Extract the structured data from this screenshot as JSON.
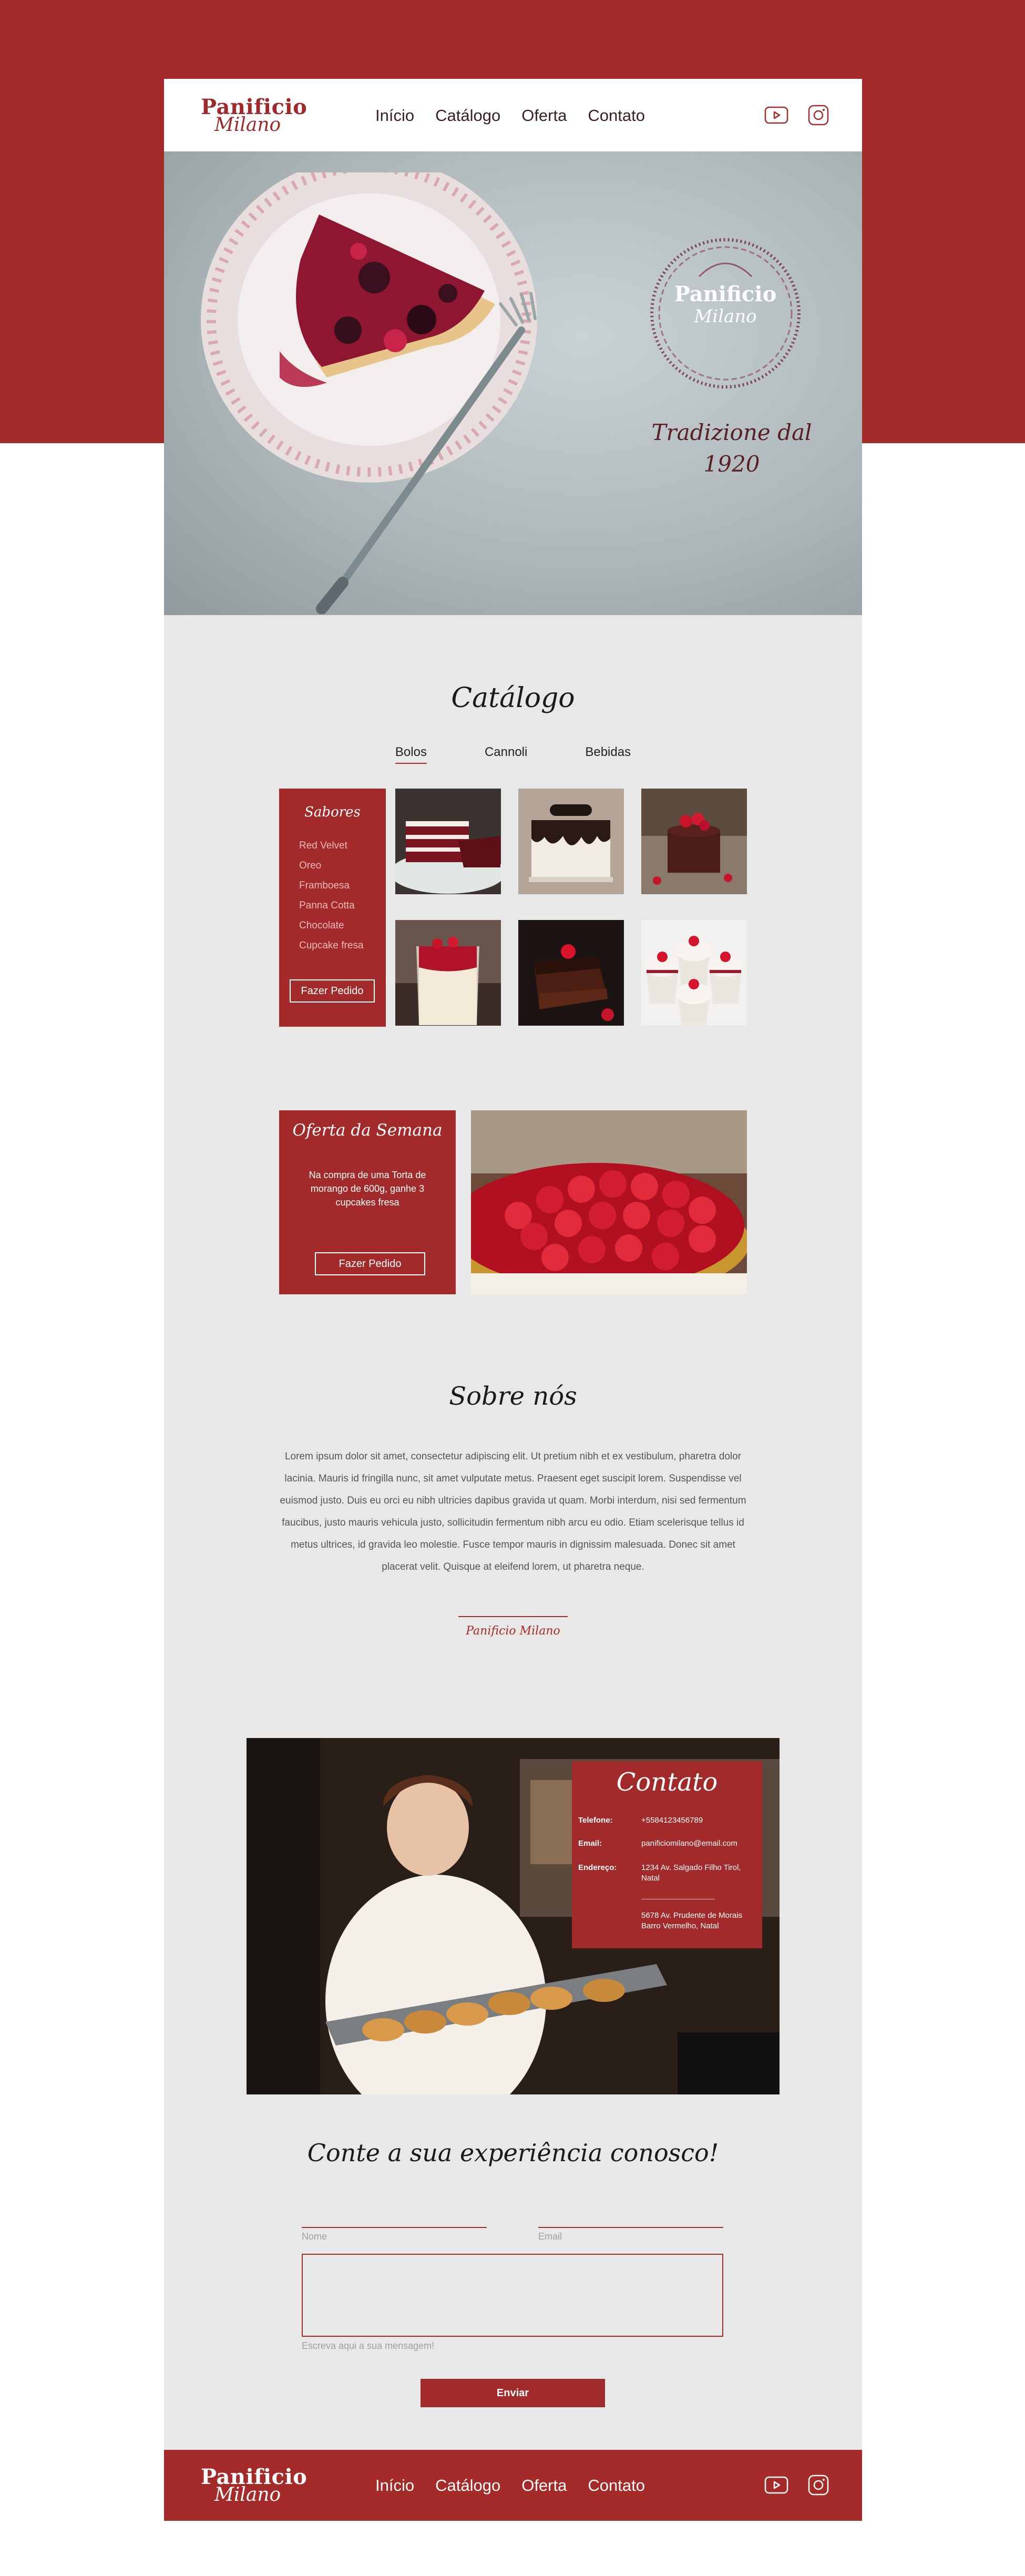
{
  "brand": {
    "line1": "Panificio",
    "line2": "Milano"
  },
  "nav": {
    "items": [
      "Início",
      "Catálogo",
      "Oferta",
      "Contato"
    ]
  },
  "social": {
    "youtube": "youtube-icon",
    "instagram": "instagram-icon"
  },
  "hero": {
    "badge_line1": "Panificio",
    "badge_line2": "Milano",
    "tagline_line1": "Tradizione dal",
    "tagline_line2": "1920"
  },
  "catalog": {
    "title": "Catálogo",
    "tabs": [
      "Bolos",
      "Cannoli",
      "Bebidas"
    ],
    "flavors_title": "Sabores",
    "flavors": [
      "Red Velvet",
      "Oreo",
      "Framboesa",
      "Panna Cotta",
      "Chocolate",
      "Cupcake fresa"
    ],
    "order_button": "Fazer Pedido"
  },
  "offer": {
    "title": "Oferta da Semana",
    "text": "Na compra de uma Torta de morango de 600g, ganhe 3 cupcakes fresa",
    "button": "Fazer Pedido"
  },
  "about": {
    "title": "Sobre nós",
    "text": "Lorem ipsum dolor sit amet, consectetur adipiscing elit. Ut pretium nibh et ex vestibulum, pharetra dolor lacinia. Mauris id fringilla nunc, sit amet vulputate metus. Praesent eget suscipit lorem. Suspendisse vel euismod justo. Duis eu orci eu nibh ultricies dapibus gravida ut quam. Morbi interdum, nisi sed fermentum faucibus, justo mauris vehicula justo, sollicitudin fermentum nibh arcu eu odio. Etiam scelerisque tellus id metus ultrices, id gravida leo molestie. Fusce tempor mauris in dignissim malesuada. Donec sit amet placerat velit. Quisque at eleifend lorem, ut pharetra neque.",
    "signature": "Panificio Milano"
  },
  "contact": {
    "title": "Contato",
    "phone_label": "Telefone:",
    "phone": "+5584123456789",
    "email_label": "Email:",
    "email": "panificiomilano@email.com",
    "address_label": "Endereço:",
    "address1": "1234 Av. Salgado Filho Tirol, Natal",
    "address2": "5678 Av. Prudente de Morais Barro Vermelho, Natal"
  },
  "form": {
    "title": "Conte a sua experiência conosco!",
    "name_placeholder": "Nome",
    "email_placeholder": "Email",
    "message_hint": "Escreva aqui a sua mensagem!",
    "submit": "Enviar"
  },
  "colors": {
    "brand_red": "#a52a2a",
    "page_bg": "#e8e8e8"
  }
}
